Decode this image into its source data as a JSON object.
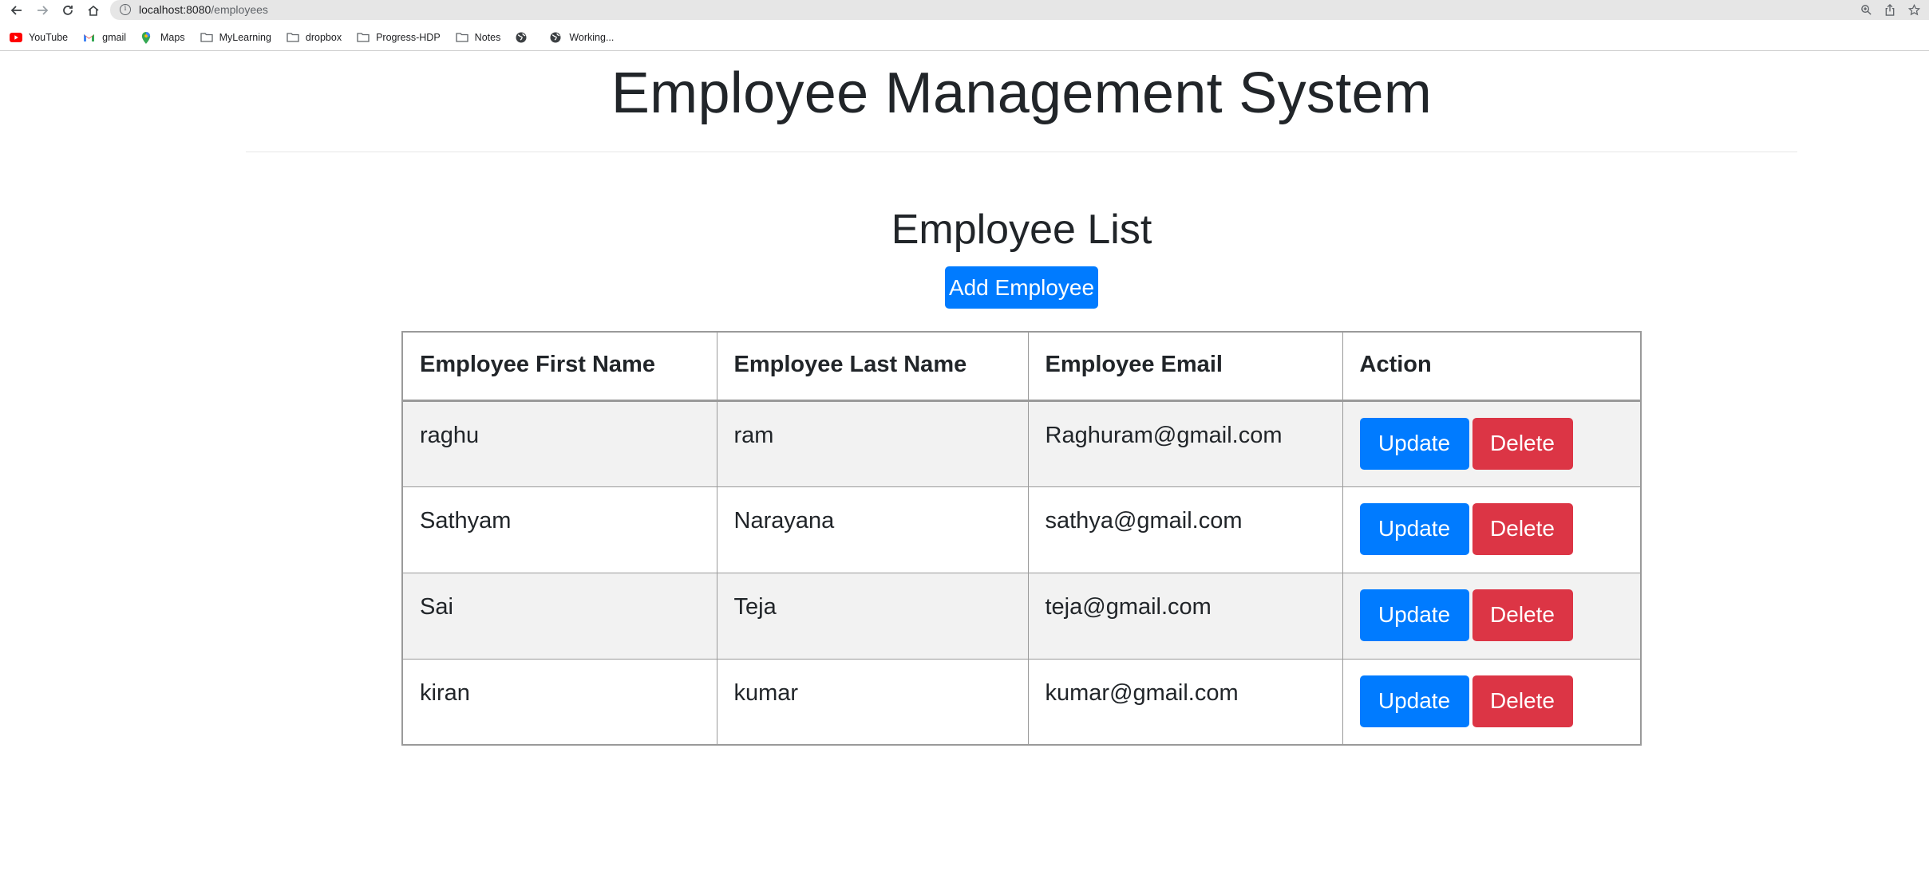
{
  "browser": {
    "url_host": "localhost:8080",
    "url_path": "/employees",
    "bookmarks": [
      {
        "label": "YouTube",
        "icon": "youtube-icon"
      },
      {
        "label": "gmail",
        "icon": "gmail-icon"
      },
      {
        "label": "Maps",
        "icon": "maps-pin-icon"
      },
      {
        "label": "MyLearning",
        "icon": "folder-icon"
      },
      {
        "label": "dropbox",
        "icon": "folder-icon"
      },
      {
        "label": "Progress-HDP",
        "icon": "folder-icon"
      },
      {
        "label": "Notes",
        "icon": "folder-icon"
      },
      {
        "label": "",
        "icon": "globe-icon"
      },
      {
        "label": "Working...",
        "icon": "globe-icon"
      }
    ]
  },
  "page": {
    "title": "Employee Management System",
    "section_title": "Employee List",
    "add_button": "Add Employee"
  },
  "table": {
    "headers": [
      "Employee First Name",
      "Employee Last Name",
      "Employee Email",
      "Action"
    ],
    "rows": [
      {
        "first": "raghu",
        "last": "ram",
        "email": "Raghuram@gmail.com"
      },
      {
        "first": "Sathyam",
        "last": "Narayana",
        "email": "sathya@gmail.com"
      },
      {
        "first": "Sai",
        "last": "Teja",
        "email": "teja@gmail.com"
      },
      {
        "first": "kiran",
        "last": "kumar",
        "email": "kumar@gmail.com"
      }
    ],
    "update_label": "Update",
    "delete_label": "Delete"
  },
  "colors": {
    "primary": "#007bff",
    "danger": "#dc3545",
    "stripe": "#f2f2f2"
  }
}
